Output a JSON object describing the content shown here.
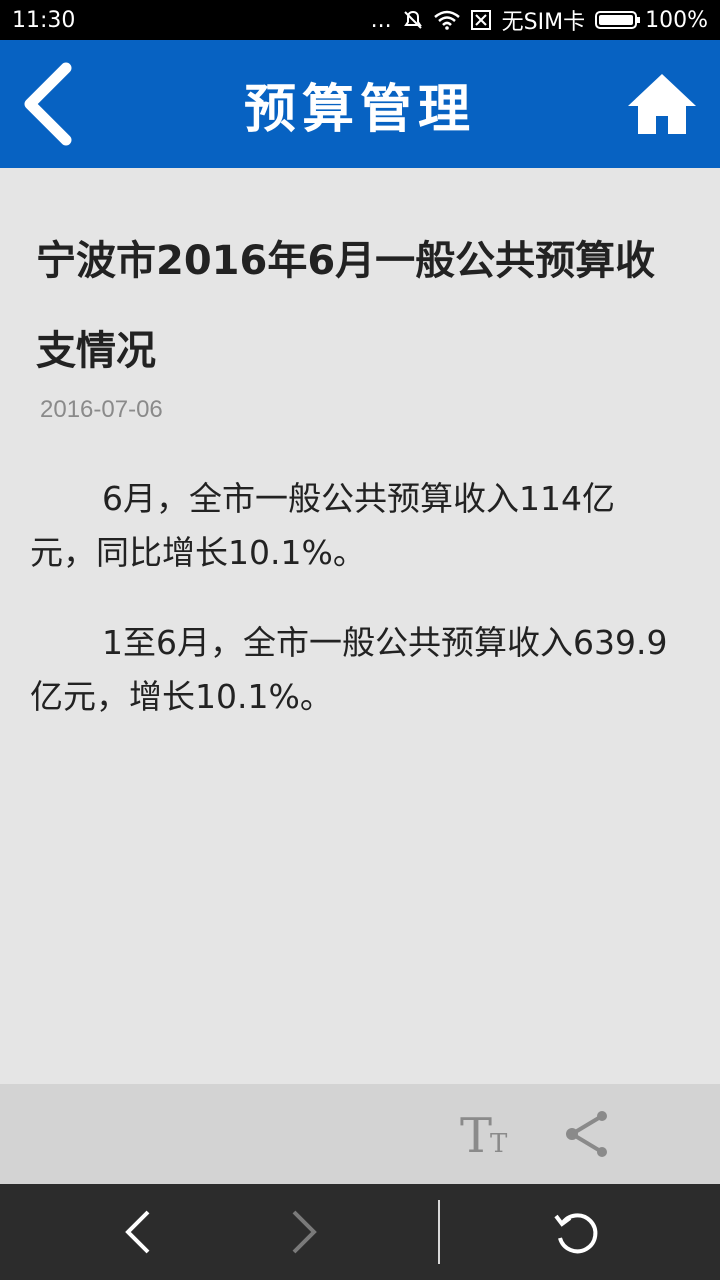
{
  "status_bar": {
    "time": "11:30",
    "dots": "...",
    "sim_text": "无SIM卡",
    "battery_text": "100%"
  },
  "header": {
    "title": "预算管理",
    "icons": [
      "back-icon",
      "home-icon"
    ]
  },
  "article": {
    "title": "宁波市2016年6月一般公共预算收支情况",
    "date": "2016-07-06",
    "paragraphs": [
      "6月，全市一般公共预算收入114亿元，同比增长10.1%。",
      "1至6月，全市一般公共预算收入639.9亿元，增长10.1%。"
    ]
  },
  "toolbar": {
    "icons": [
      "font-size-icon",
      "share-icon"
    ]
  },
  "nav": {
    "icons": [
      "back-nav-icon",
      "forward-nav-icon",
      "refresh-icon"
    ]
  },
  "colors": {
    "header_bg": "#0762c2",
    "page_bg": "#e5e5e5",
    "toolbar_bg": "#d3d3d3",
    "navbar_bg": "#2c2c2c"
  }
}
